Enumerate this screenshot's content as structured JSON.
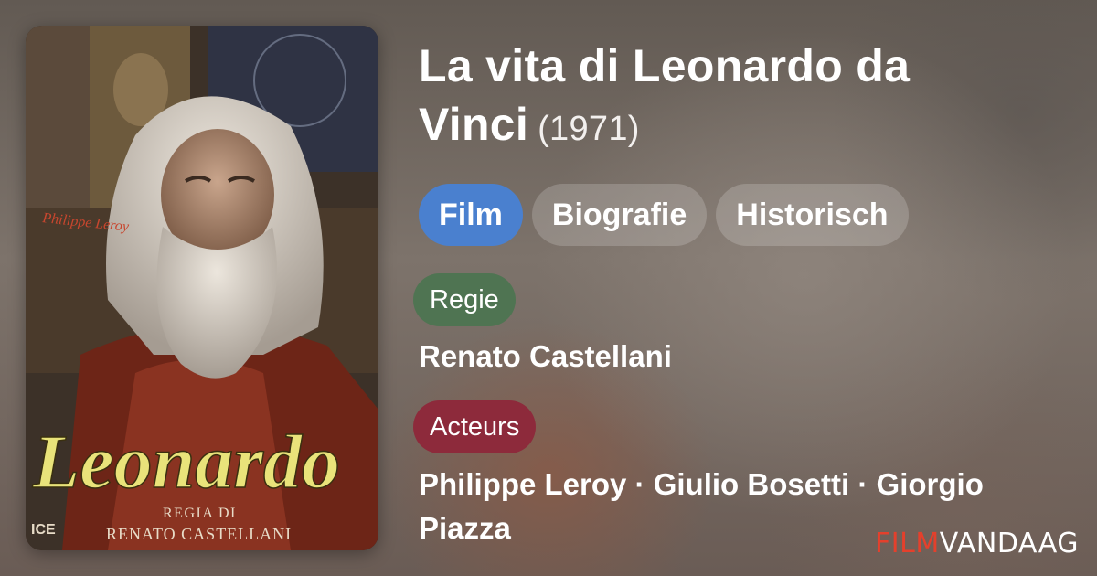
{
  "movie": {
    "title": "La vita di Leonardo da Vinci",
    "year": "(1971)"
  },
  "genres": [
    {
      "label": "Film"
    },
    {
      "label": "Biografie"
    },
    {
      "label": "Historisch"
    }
  ],
  "director_section": {
    "label": "Regie",
    "name": "Renato Castellani"
  },
  "actors_section": {
    "label": "Acteurs",
    "names": "Philippe Leroy · Giulio Bosetti · Giorgio Piazza"
  },
  "poster": {
    "title_text": "Leonardo",
    "credit_line_1": "REGIA DI",
    "credit_line_2": "RENATO CASTELLANI",
    "name_text": "Philippe Leroy",
    "logo_text": "ICE"
  },
  "brand": {
    "part1": "FILM",
    "part2": "VANDAAG"
  },
  "colors": {
    "genre_primary": "#4a80cf",
    "director_tag": "#4f7452",
    "actors_tag": "#8d2a3b",
    "brand_red": "#e4402c"
  }
}
